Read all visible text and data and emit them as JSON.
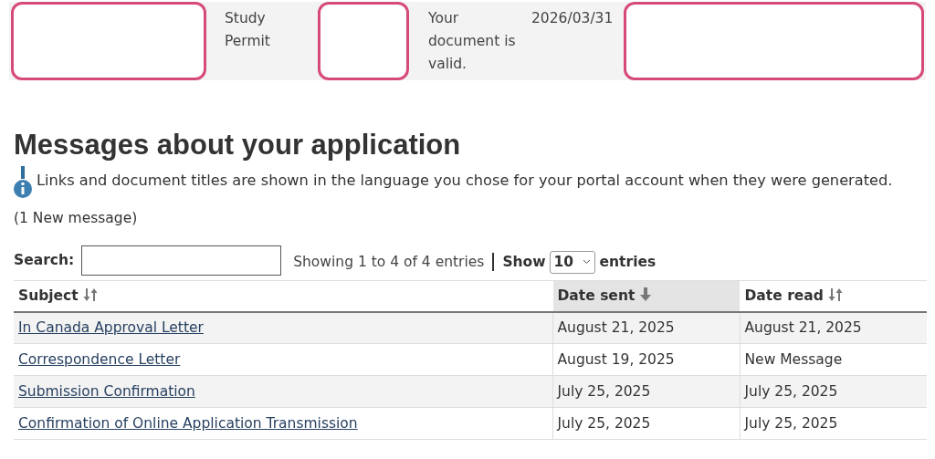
{
  "document_strip": {
    "cells": [
      {
        "kind": "redacted"
      },
      {
        "kind": "text",
        "text": "Study Permit"
      },
      {
        "kind": "redacted"
      },
      {
        "kind": "text",
        "text": "Your document is valid."
      },
      {
        "kind": "text",
        "text": "2026/03/31"
      },
      {
        "kind": "redacted"
      }
    ]
  },
  "heading": "Messages about your application",
  "info_note": "Links and document titles are shown in the language you chose for your portal account when they were generated.",
  "new_count": "(1 New message)",
  "search": {
    "label": "Search:"
  },
  "info": "Showing 1 to 4 of 4 entries",
  "length": {
    "label_before": "Show",
    "value": "10",
    "label_after": "entries"
  },
  "table": {
    "columns": [
      {
        "label": "Subject",
        "kind": "sortable",
        "selected": false
      },
      {
        "label": "Date sent",
        "kind": "sorted-descending",
        "selected": true
      },
      {
        "label": "Date read",
        "kind": "sortable",
        "selected": false
      }
    ],
    "rows": [
      [
        "In Canada Approval Letter",
        "August 21, 2025",
        "August 21, 2025"
      ],
      [
        "Correspondence Letter",
        "August 19, 2025",
        "New Message"
      ],
      [
        "Submission Confirmation",
        "July 25, 2025",
        "July 25, 2025"
      ],
      [
        "Confirmation of Online Application Transmission",
        "July 25, 2025",
        "July 25, 2025"
      ]
    ]
  }
}
